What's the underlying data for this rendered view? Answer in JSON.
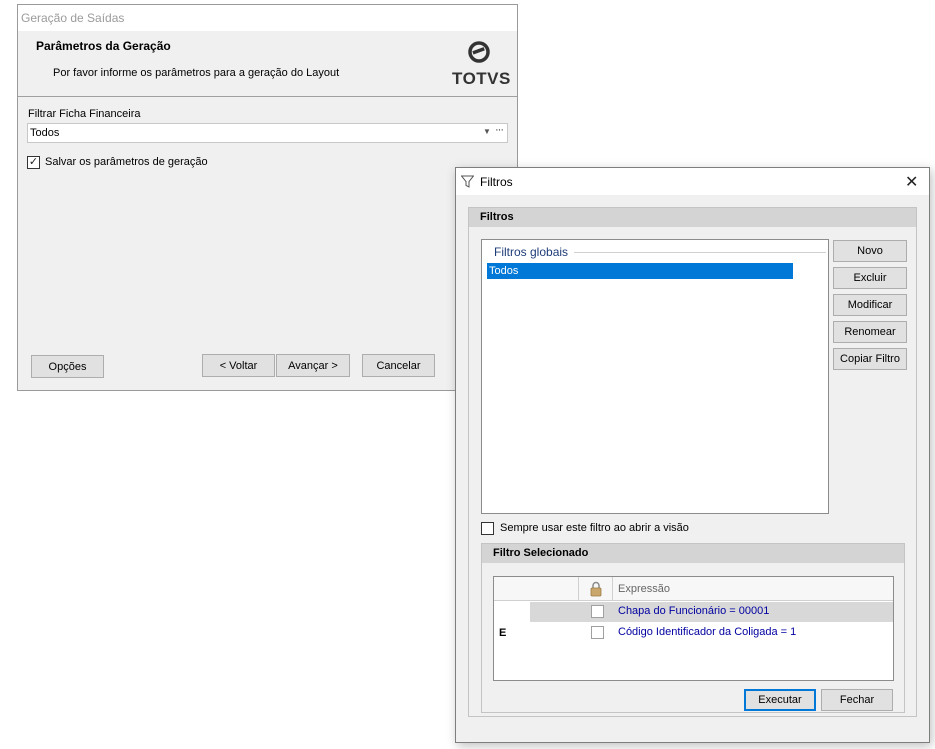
{
  "main_window": {
    "title": "Geração de Saídas",
    "header": {
      "title": "Parâmetros da Geração",
      "subtitle": "Por favor informe os parâmetros para a geração do Layout",
      "logo_text": "TOTVS"
    },
    "filter_label": "Filtrar Ficha Financeira",
    "filter_value": "Todos",
    "combo_dots": "···",
    "save_params": {
      "checked": true,
      "label": "Salvar os parâmetros de geração"
    },
    "buttons": {
      "options": "Opções",
      "back": "< Voltar",
      "next": "Avançar >",
      "cancel": "Cancelar"
    }
  },
  "filter_dialog": {
    "title": "Filtros",
    "close_glyph": "✕",
    "panel_title": "Filtros",
    "list_group": "Filtros globais",
    "list_items": [
      "Todos"
    ],
    "buttons": {
      "new": "Novo",
      "delete": "Excluir",
      "modify": "Modificar",
      "rename": "Renomear",
      "copy": "Copiar Filtro"
    },
    "always_use": {
      "checked": false,
      "label": "Sempre usar este filtro ao abrir a visão"
    },
    "selected_panel": {
      "title": "Filtro Selecionado",
      "column_expression": "Expressão",
      "rows": [
        {
          "operator": "",
          "locked": false,
          "expression": "Chapa do Funcionário = 00001"
        },
        {
          "operator": "E",
          "locked": false,
          "expression": "Código Identificador da Coligada = 1"
        }
      ]
    },
    "execute_button": "Executar",
    "close_button": "Fechar"
  },
  "colors": {
    "selection": "#0078d7",
    "expression_text": "#0000a0",
    "panel_header": "#d4d4d4"
  }
}
